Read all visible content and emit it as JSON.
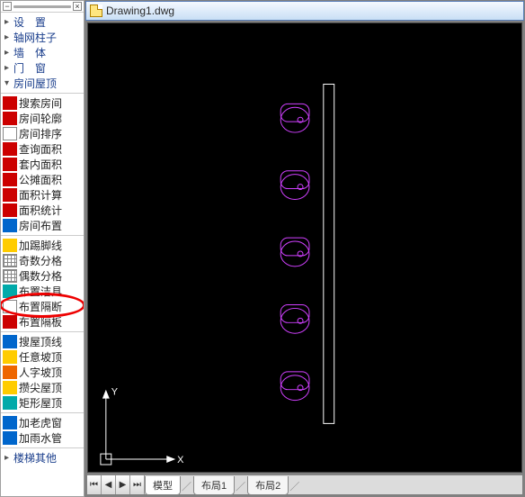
{
  "sidebar": {
    "tree": [
      {
        "label": "设　置"
      },
      {
        "label": "轴网柱子"
      },
      {
        "label": "墙　体"
      },
      {
        "label": "门　窗"
      },
      {
        "label": "房间屋顶"
      }
    ],
    "group_room": [
      {
        "icon": "ic-red",
        "label": "搜索房间"
      },
      {
        "icon": "ic-red",
        "label": "房间轮廓"
      },
      {
        "icon": "ic-white",
        "label": "房间排序"
      },
      {
        "icon": "ic-red",
        "label": "查询面积"
      },
      {
        "icon": "ic-red",
        "label": "套内面积"
      },
      {
        "icon": "ic-red",
        "label": "公摊面积"
      },
      {
        "icon": "ic-red",
        "label": "面积计算"
      },
      {
        "icon": "ic-red",
        "label": "面积统计"
      },
      {
        "icon": "ic-blue",
        "label": "房间布置"
      }
    ],
    "group_layout": [
      {
        "icon": "ic-yel",
        "label": "加踢脚线"
      },
      {
        "icon": "ic-grid",
        "label": "奇数分格"
      },
      {
        "icon": "ic-grid",
        "label": "偶数分格"
      },
      {
        "icon": "ic-teal",
        "label": "布置洁具"
      },
      {
        "icon": "ic-white",
        "label": "布置隔断",
        "highlight": true
      },
      {
        "icon": "ic-red",
        "label": "布置隔板"
      }
    ],
    "group_roof": [
      {
        "icon": "ic-blue",
        "label": "搜屋顶线"
      },
      {
        "icon": "ic-yel",
        "label": "任意坡顶"
      },
      {
        "icon": "ic-orange",
        "label": "人字坡顶"
      },
      {
        "icon": "ic-yel",
        "label": "攒尖屋顶"
      },
      {
        "icon": "ic-teal",
        "label": "矩形屋顶"
      }
    ],
    "group_misc": [
      {
        "icon": "ic-blue",
        "label": "加老虎窗"
      },
      {
        "icon": "ic-blue",
        "label": "加雨水管"
      }
    ],
    "tree_bottom": [
      {
        "label": "楼梯其他"
      }
    ]
  },
  "document": {
    "title": "Drawing1.dwg"
  },
  "canvas": {
    "axis_x": "X",
    "axis_y": "Y"
  },
  "tabs": {
    "items": [
      {
        "label": "模型",
        "active": true
      },
      {
        "label": "布局1",
        "active": false
      },
      {
        "label": "布局2",
        "active": false
      }
    ]
  }
}
